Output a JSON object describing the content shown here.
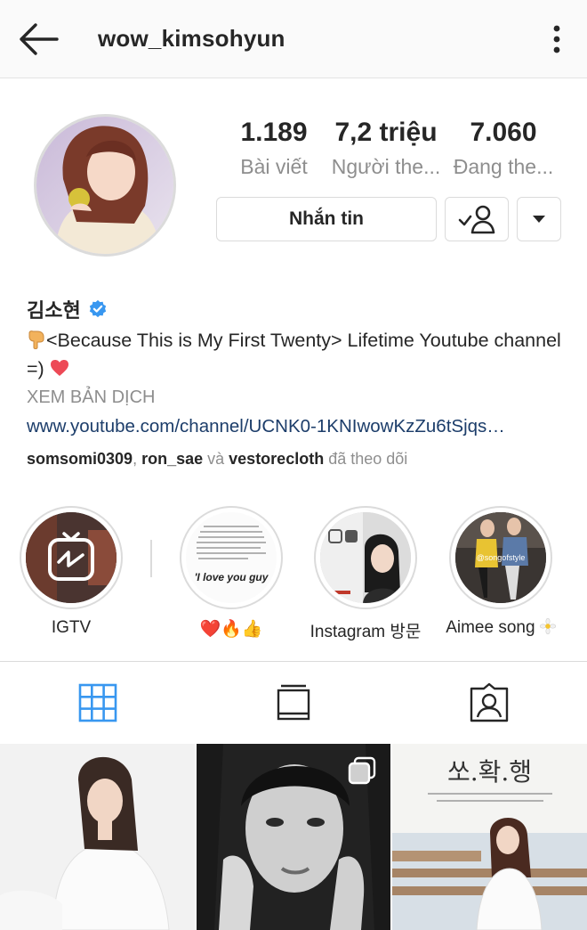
{
  "header": {
    "username": "wow_kimsohyun",
    "back_icon": "arrow-left-icon",
    "more_icon": "more-vertical-icon"
  },
  "profile": {
    "stats": [
      {
        "value": "1.189",
        "label": "Bài viết"
      },
      {
        "value": "7,2 triệu",
        "label": "Người the..."
      },
      {
        "value": "7.060",
        "label": "Đang the..."
      }
    ],
    "message_label": "Nhắn tin",
    "full_name": "김소현",
    "bio_line": "<Because This is My First Twenty>  Lifetime Youtube channel =) ",
    "translate_label": "XEM BẢN DỊCH",
    "link": "www.youtube.com/channel/UCNK0-1KNIwowKzZu6tSjqs…",
    "followed_by": {
      "user1": "somsomi0309",
      "sep": ", ",
      "user2": "ron_sae",
      "and": " và ",
      "user3": "vestorecloth",
      "suffix": " đã theo dõi"
    }
  },
  "highlights": [
    {
      "label": "IGTV"
    },
    {
      "label": "❤️🔥👍",
      "text": "'I love you guy"
    },
    {
      "label": "Instagram 방문"
    },
    {
      "label": "Aimee song",
      "overlay": "@songofstyle"
    }
  ],
  "colors": {
    "verified": "#3897f0",
    "heart": "#ed4956",
    "link": "#1c3d6a",
    "tab_active": "#3897f0",
    "secondary_text": "#8e8e8e"
  },
  "grid": {
    "post3_title": "쏘.확.행"
  }
}
